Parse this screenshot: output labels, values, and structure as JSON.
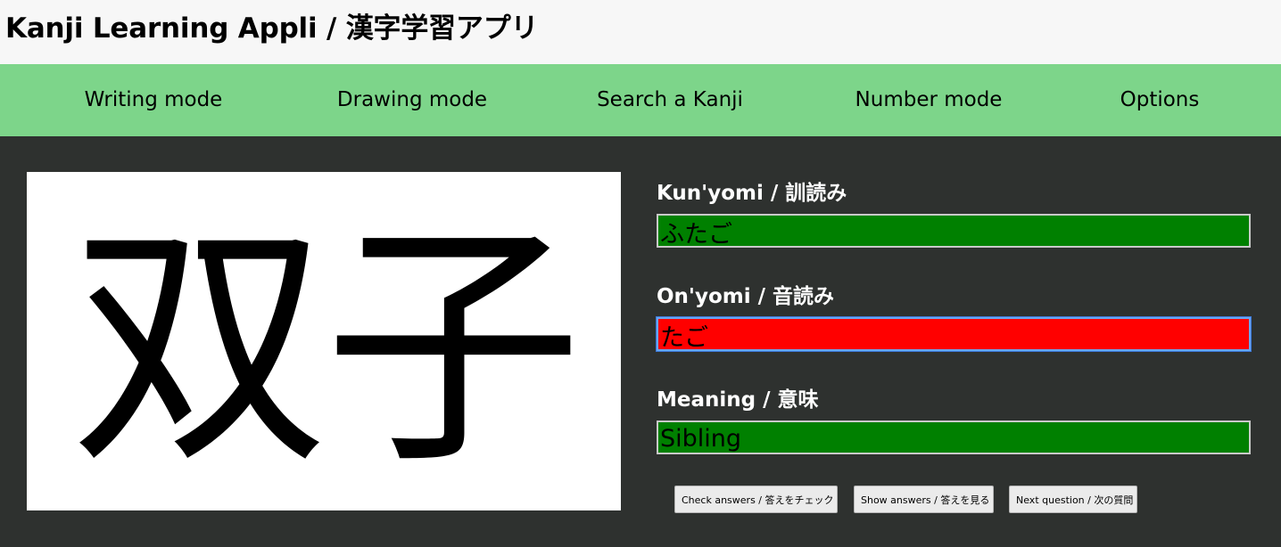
{
  "app": {
    "title": "Kanji Learning Appli / 漢字学習アプリ"
  },
  "nav": {
    "items": [
      {
        "label": "Writing mode"
      },
      {
        "label": "Drawing mode"
      },
      {
        "label": "Search a Kanji"
      },
      {
        "label": "Number mode"
      },
      {
        "label": "Options"
      }
    ]
  },
  "kanji": {
    "character": "双子"
  },
  "fields": {
    "kunyomi": {
      "label": "Kun'yomi / 訓読み",
      "value": "ふたご",
      "status": "correct"
    },
    "onyomi": {
      "label": "On'yomi / 音読み",
      "value": "たご",
      "status": "incorrect"
    },
    "meaning": {
      "label": "Meaning / 意味",
      "value": "Sibling",
      "status": "correct"
    }
  },
  "buttons": {
    "check": "Check answers / 答えをチェック",
    "show": "Show answers / 答えを見る",
    "next": "Next question / 次の質問"
  },
  "colors": {
    "header_bg": "#f7f7f7",
    "nav_bg": "#7dd58a",
    "main_bg": "#2e312f",
    "correct": "#008000",
    "incorrect": "#ff0000"
  }
}
